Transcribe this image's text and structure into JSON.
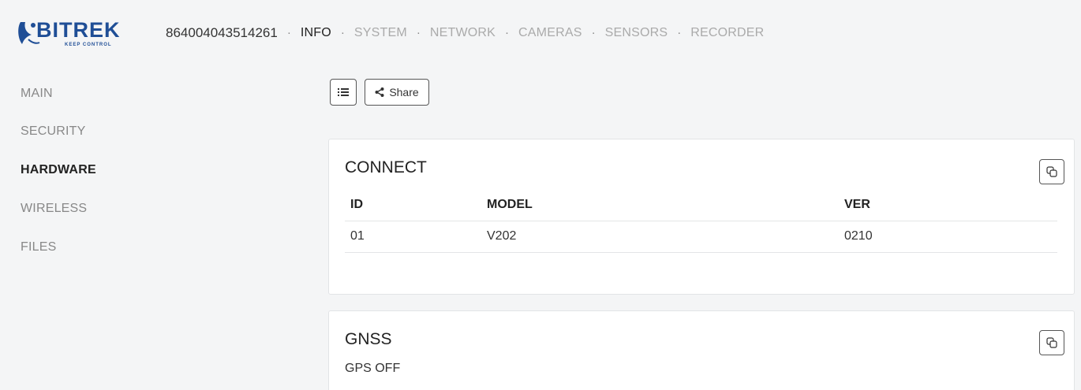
{
  "header": {
    "logo_text": "BITREK",
    "logo_tagline": "KEEP CONTROL",
    "device_id": "864004043514261",
    "separator": "·",
    "nav": [
      {
        "label": "INFO",
        "active": true
      },
      {
        "label": "SYSTEM",
        "active": false
      },
      {
        "label": "NETWORK",
        "active": false
      },
      {
        "label": "CAMERAS",
        "active": false
      },
      {
        "label": "SENSORS",
        "active": false
      },
      {
        "label": "RECORDER",
        "active": false
      }
    ]
  },
  "sidebar": {
    "items": [
      {
        "label": "MAIN",
        "active": false
      },
      {
        "label": "SECURITY",
        "active": false
      },
      {
        "label": "HARDWARE",
        "active": true
      },
      {
        "label": "WIRELESS",
        "active": false
      },
      {
        "label": "FILES",
        "active": false
      }
    ]
  },
  "toolbar": {
    "list_icon": "list-icon",
    "share_label": "Share",
    "share_icon": "share-icon"
  },
  "cards": {
    "connect": {
      "title": "CONNECT",
      "copy_icon": "copy-icon",
      "columns": [
        "ID",
        "MODEL",
        "VER"
      ],
      "rows": [
        [
          "01",
          "V202",
          "0210"
        ]
      ]
    },
    "gnss": {
      "title": "GNSS",
      "copy_icon": "copy-icon",
      "status": "GPS OFF"
    }
  },
  "colors": {
    "logo_blue": "#1f4e96",
    "background": "#f4f5f6",
    "card": "#ffffff",
    "inactive_text": "#aaaaaa"
  }
}
